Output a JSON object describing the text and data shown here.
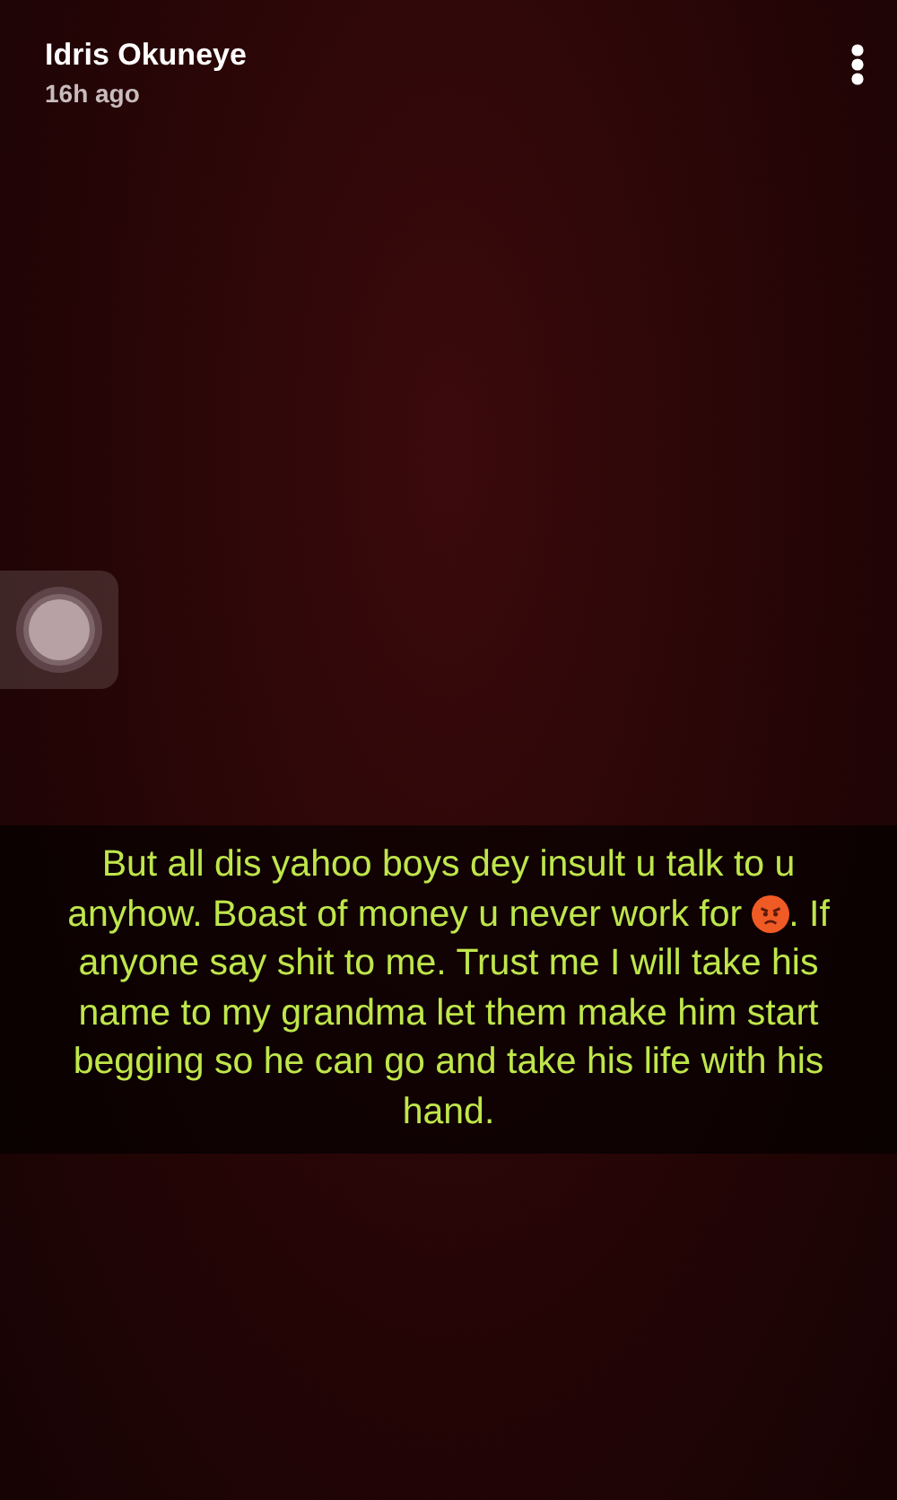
{
  "header": {
    "name": "Idris Okuneye",
    "time": "16h ago"
  },
  "caption_lines": [
    {
      "kind": "text",
      "text": "But all dis yahoo boys dey insult u talk to u"
    },
    {
      "kind": "emoji",
      "before": "anyhow. Boast of money u never work for",
      "after": ". If"
    },
    {
      "kind": "text",
      "text": "anyone say shit to me. Trust me I will take his"
    },
    {
      "kind": "text",
      "text": "name to my grandma let them make him start"
    },
    {
      "kind": "text",
      "text": "begging so he can go and take his life with his"
    },
    {
      "kind": "text",
      "text": "hand."
    }
  ]
}
